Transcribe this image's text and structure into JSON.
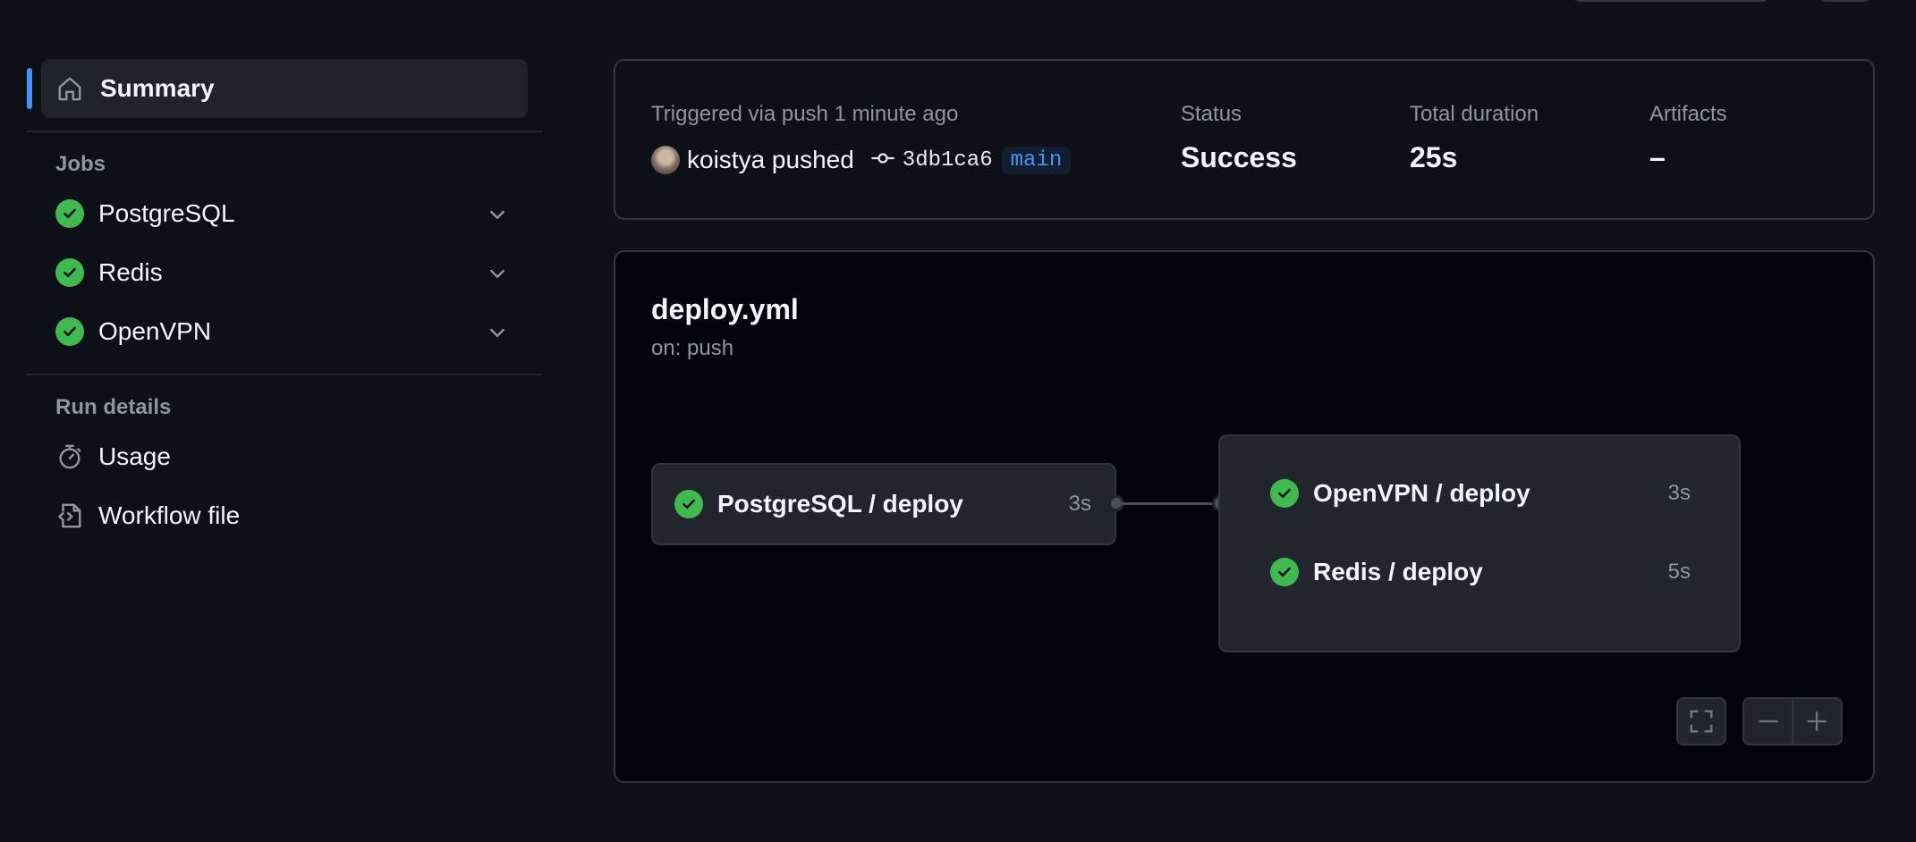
{
  "sidebar": {
    "summary_label": "Summary",
    "jobs_title": "Jobs",
    "jobs": [
      {
        "label": "PostgreSQL",
        "status": "success"
      },
      {
        "label": "Redis",
        "status": "success"
      },
      {
        "label": "OpenVPN",
        "status": "success"
      }
    ],
    "run_details_title": "Run details",
    "run_details": [
      {
        "label": "Usage",
        "icon": "stopwatch-icon"
      },
      {
        "label": "Workflow file",
        "icon": "file-code-icon"
      }
    ]
  },
  "summary": {
    "trigger_text": "Triggered via push 1 minute ago",
    "pusher": "koistya pushed",
    "commit_sha": "3db1ca6",
    "branch": "main",
    "status_label": "Status",
    "status_value": "Success",
    "duration_label": "Total duration",
    "duration_value": "25s",
    "artifacts_label": "Artifacts",
    "artifacts_value": "–"
  },
  "graph": {
    "title": "deploy.yml",
    "subtitle": "on: push",
    "stage1": [
      {
        "name": "PostgreSQL / deploy",
        "duration": "3s"
      }
    ],
    "stage2": [
      {
        "name": "OpenVPN / deploy",
        "duration": "3s"
      },
      {
        "name": "Redis / deploy",
        "duration": "5s"
      }
    ]
  },
  "colors": {
    "background": "#0d1117",
    "accent": "#4493f8",
    "success": "#3fb950",
    "muted": "#8d96a0"
  }
}
